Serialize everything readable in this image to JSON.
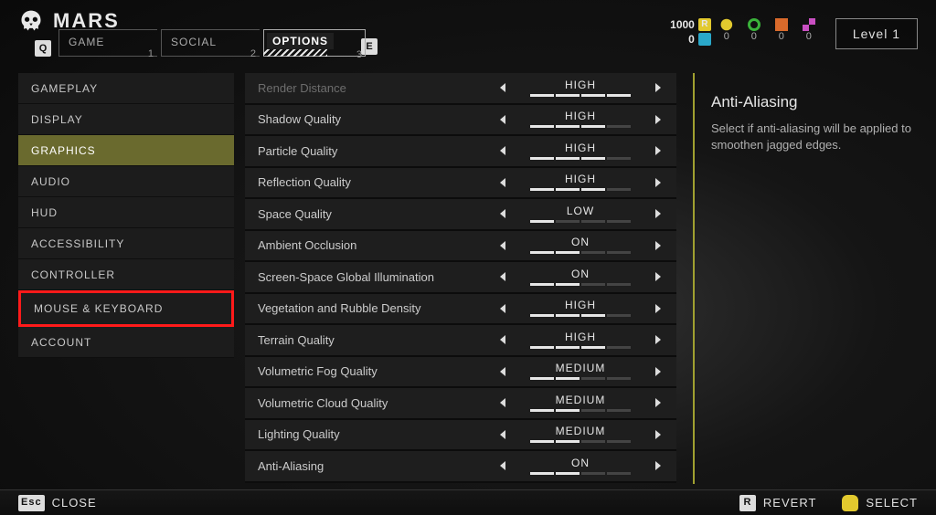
{
  "header": {
    "title": "MARS",
    "keycap_left": "Q",
    "keycap_right": "E",
    "tabs": [
      {
        "label": "GAME",
        "num": "1"
      },
      {
        "label": "SOCIAL",
        "num": "2"
      },
      {
        "label": "OPTIONS",
        "num": "3",
        "active": true
      }
    ]
  },
  "top_right": {
    "currency_value": "1000",
    "currency_icon": "R",
    "sub_value": "0",
    "resources": [
      {
        "icon": "gear",
        "color": "#e2c92e",
        "value": "0"
      },
      {
        "icon": "orb",
        "color": "#3ab23a",
        "value": "0"
      },
      {
        "icon": "box",
        "color": "#d96a2b",
        "value": "0"
      },
      {
        "icon": "grid",
        "color": "#c94fc2",
        "value": "0"
      }
    ],
    "level_label": "Level 1"
  },
  "sidebar": {
    "items": [
      {
        "label": "GAMEPLAY"
      },
      {
        "label": "DISPLAY"
      },
      {
        "label": "GRAPHICS",
        "active": true
      },
      {
        "label": "AUDIO"
      },
      {
        "label": "HUD"
      },
      {
        "label": "ACCESSIBILITY"
      },
      {
        "label": "CONTROLLER"
      },
      {
        "label": "MOUSE & KEYBOARD",
        "highlight": true
      },
      {
        "label": "ACCOUNT"
      }
    ]
  },
  "settings": [
    {
      "label": "Render Distance",
      "value": "HIGH",
      "fill": 4,
      "partial": true
    },
    {
      "label": "Shadow Quality",
      "value": "HIGH",
      "fill": 3
    },
    {
      "label": "Particle Quality",
      "value": "HIGH",
      "fill": 3
    },
    {
      "label": "Reflection Quality",
      "value": "HIGH",
      "fill": 3
    },
    {
      "label": "Space Quality",
      "value": "LOW",
      "fill": 1
    },
    {
      "label": "Ambient Occlusion",
      "value": "ON",
      "fill": 2
    },
    {
      "label": "Screen-Space Global Illumination",
      "value": "ON",
      "fill": 2
    },
    {
      "label": "Vegetation and Rubble Density",
      "value": "HIGH",
      "fill": 3
    },
    {
      "label": "Terrain Quality",
      "value": "HIGH",
      "fill": 3
    },
    {
      "label": "Volumetric Fog Quality",
      "value": "MEDIUM",
      "fill": 2
    },
    {
      "label": "Volumetric Cloud Quality",
      "value": "MEDIUM",
      "fill": 2
    },
    {
      "label": "Lighting Quality",
      "value": "MEDIUM",
      "fill": 2
    },
    {
      "label": "Anti-Aliasing",
      "value": "ON",
      "fill": 2
    }
  ],
  "right_panel": {
    "title": "Anti-Aliasing",
    "description": "Select if anti-aliasing will be applied to smoothen jagged edges."
  },
  "footer": {
    "close_key": "Esc",
    "close_label": "CLOSE",
    "revert_key": "R",
    "revert_label": "REVERT",
    "select_label": "SELECT"
  }
}
